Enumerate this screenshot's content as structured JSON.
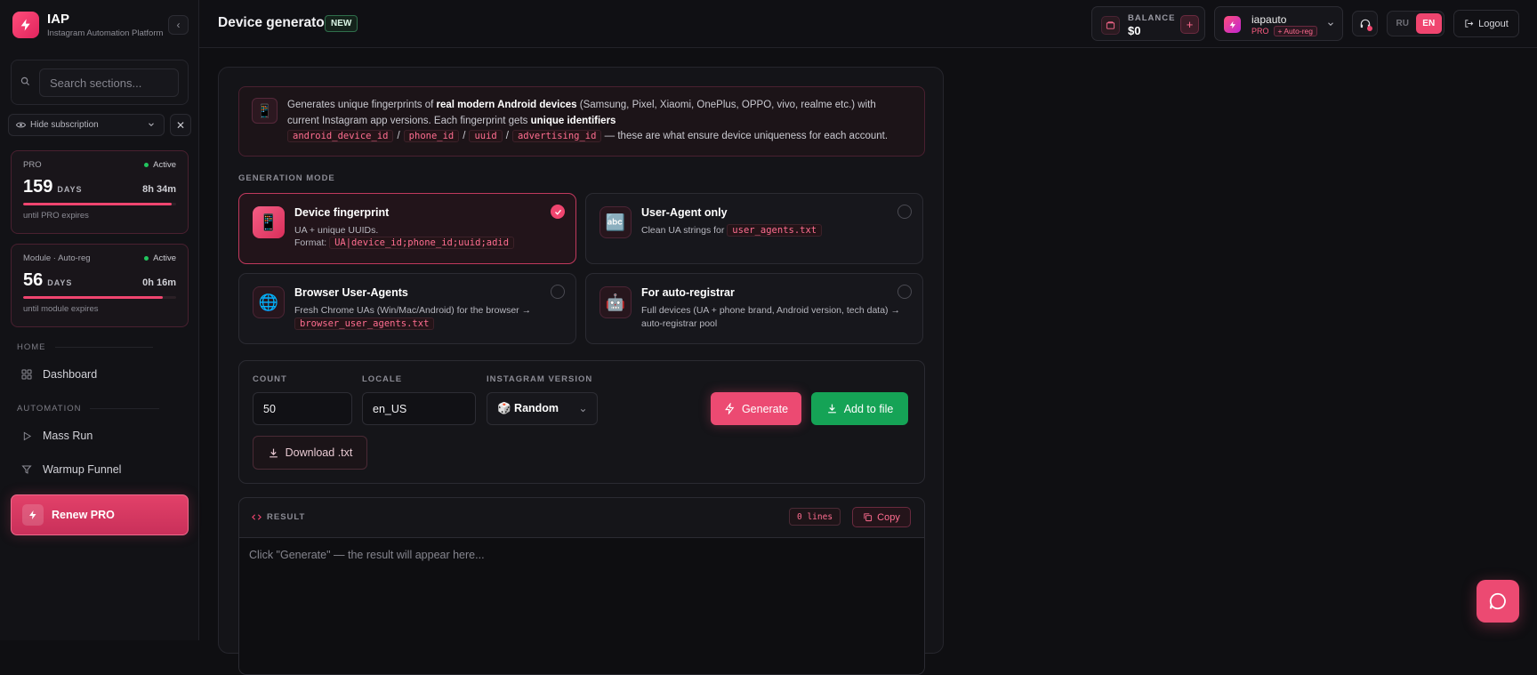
{
  "brand": {
    "name": "IAP",
    "subtitle": "Instagram Automation Platform"
  },
  "sidebar": {
    "search_placeholder": "Search sections...",
    "hide_subscription_label": "Hide subscription",
    "subscriptions": [
      {
        "tier": "PRO",
        "status": "Active",
        "days": "159",
        "days_label": "DAYS",
        "time": "8h 34m",
        "progress": 0.97,
        "until": "until PRO expires"
      },
      {
        "tier": "Module · Auto-reg",
        "status": "Active",
        "days": "56",
        "days_label": "DAYS",
        "time": "0h 16m",
        "progress": 0.91,
        "until": "until module expires"
      }
    ],
    "sections": [
      {
        "title": "HOME",
        "items": [
          {
            "label": "Dashboard",
            "icon": "grid-icon"
          }
        ]
      },
      {
        "title": "AUTOMATION",
        "items": [
          {
            "label": "Mass Run",
            "icon": "play-icon"
          },
          {
            "label": "Warmup Funnel",
            "icon": "funnel-icon"
          }
        ]
      }
    ],
    "renew_label": "Renew PRO"
  },
  "header": {
    "title": "Device generator",
    "badge": "NEW",
    "balance_label": "BALANCE",
    "balance_value": "$0",
    "add_balance": "+",
    "username": "iapauto",
    "user_tier": "PRO",
    "user_module": "+ Auto-reg",
    "lang": [
      "RU",
      "EN"
    ],
    "lang_active": "EN",
    "logout_label": "Logout"
  },
  "info": {
    "t1": "Generates unique fingerprints of ",
    "b1": "real modern Android devices",
    "t2": " (Samsung, Pixel, Xiaomi, OnePlus, OPPO, vivo, realme etc.) with current Instagram app versions. Each fingerprint gets ",
    "b2": "unique identifiers",
    "codes": [
      "android_device_id",
      "phone_id",
      "uuid",
      "advertising_id"
    ],
    "sep": "/",
    "t3": " — these are what ensure device uniqueness for each account."
  },
  "mode": {
    "section_label": "GENERATION MODE",
    "cards": [
      {
        "title": "Device fingerprint",
        "desc": "UA + unique UUIDs.",
        "format_label": "Format:",
        "code": "UA|device_id;phone_id;uuid;adid",
        "selected": true
      },
      {
        "title": "User-Agent only",
        "desc": "Clean UA strings for",
        "code": "user_agents.txt",
        "selected": false
      },
      {
        "title": "Browser User-Agents",
        "desc": "Fresh Chrome UAs (Win/Mac/Android) for the browser →",
        "code": "browser_user_agents.txt",
        "selected": false
      },
      {
        "title": "For auto-registrar",
        "desc": "Full devices (UA + phone brand, Android version, tech data) → auto-registrar pool",
        "selected": false
      }
    ]
  },
  "form": {
    "count_label": "COUNT",
    "count_value": "50",
    "locale_label": "LOCALE",
    "locale_value": "en_US",
    "version_label": "INSTAGRAM VERSION",
    "version_value": "🎲 Random",
    "generate_label": "Generate",
    "add_label": "Add to file",
    "download_label": "Download .txt"
  },
  "result": {
    "label": "RESULT",
    "lines": "0 lines",
    "copy_label": "Copy",
    "placeholder": "Click \"Generate\" — the result will appear here..."
  },
  "colors": {
    "accent": "#ec4a72",
    "success": "#15a356",
    "bg": "#0f0f12"
  }
}
